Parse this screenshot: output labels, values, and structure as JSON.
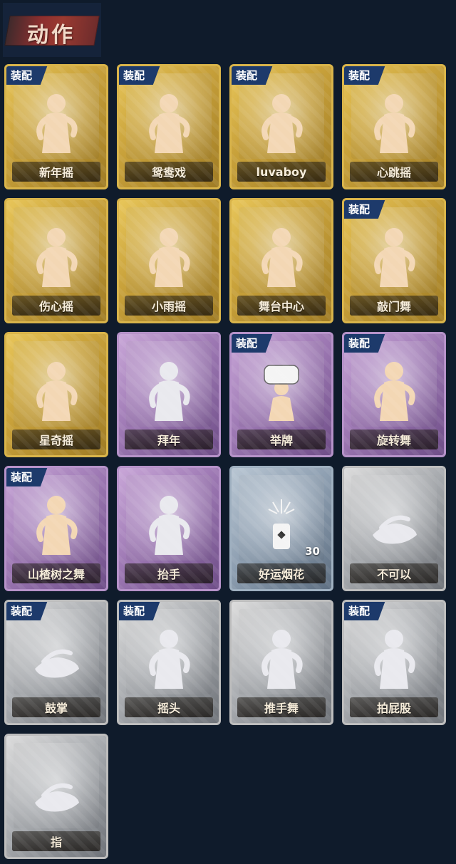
{
  "header": {
    "title": "动作"
  },
  "badge_label": "装配",
  "tier_colors": {
    "gold": "#d9b44a",
    "purple": "#b692c9",
    "blue": "#9fb0c0",
    "silver": "#bdbdbd",
    "badge": "#1d3a6b",
    "background": "#0f1b2b"
  },
  "actions": [
    {
      "name": "新年摇",
      "tier": "gold",
      "equipped": true,
      "icon": "shake-figure-icon"
    },
    {
      "name": "鸳鸯戏",
      "tier": "gold",
      "equipped": true,
      "icon": "dance-figure-icon"
    },
    {
      "name": "luvaboy",
      "tier": "gold",
      "equipped": true,
      "icon": "dance-figure-icon"
    },
    {
      "name": "心跳摇",
      "tier": "gold",
      "equipped": true,
      "icon": "dance-figure-icon"
    },
    {
      "name": "伤心摇",
      "tier": "gold",
      "equipped": false,
      "icon": "heart-hands-figure-icon"
    },
    {
      "name": "小雨摇",
      "tier": "gold",
      "equipped": false,
      "icon": "dance-figure-icon"
    },
    {
      "name": "舞台中心",
      "tier": "gold",
      "equipped": false,
      "icon": "sparkle-figure-icon"
    },
    {
      "name": "敲门舞",
      "tier": "gold",
      "equipped": true,
      "icon": "knock-figure-icon"
    },
    {
      "name": "星奇摇",
      "tier": "gold",
      "equipped": false,
      "icon": "sparkle-figure-icon"
    },
    {
      "name": "拜年",
      "tier": "purple",
      "equipped": false,
      "icon": "bow-figure-icon"
    },
    {
      "name": "举牌",
      "tier": "purple",
      "equipped": true,
      "icon": "sign-figure-icon"
    },
    {
      "name": "旋转舞",
      "tier": "purple",
      "equipped": true,
      "icon": "spin-figure-icon"
    },
    {
      "name": "山楂树之舞",
      "tier": "purple",
      "equipped": true,
      "icon": "dance-figure-icon"
    },
    {
      "name": "抬手",
      "tier": "purple",
      "equipped": false,
      "icon": "raise-hand-figure-icon"
    },
    {
      "name": "好运烟花",
      "tier": "blue",
      "equipped": false,
      "icon": "firework-icon",
      "count": "30"
    },
    {
      "name": "不可以",
      "tier": "silver",
      "equipped": false,
      "icon": "finger-wag-icon"
    },
    {
      "name": "鼓掌",
      "tier": "silver",
      "equipped": true,
      "icon": "clap-hands-icon"
    },
    {
      "name": "摇头",
      "tier": "silver",
      "equipped": true,
      "icon": "shake-head-figure-icon"
    },
    {
      "name": "推手舞",
      "tier": "silver",
      "equipped": false,
      "icon": "push-hands-figure-icon"
    },
    {
      "name": "拍屁股",
      "tier": "silver",
      "equipped": true,
      "icon": "pat-figure-icon"
    },
    {
      "name": "指",
      "tier": "silver",
      "equipped": false,
      "icon": "point-hand-icon"
    }
  ]
}
